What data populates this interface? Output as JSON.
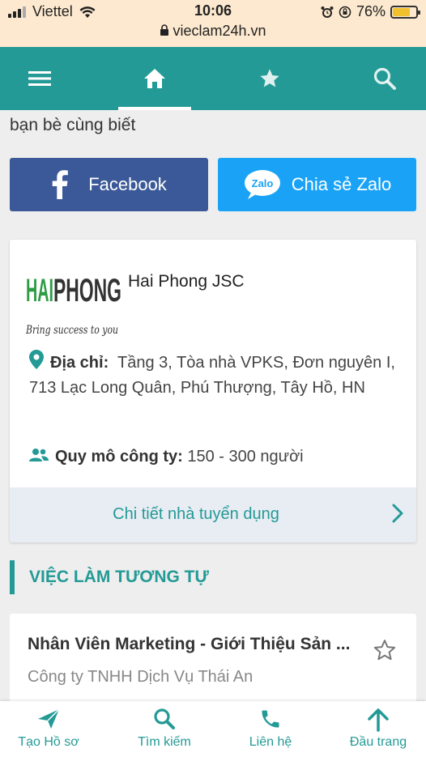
{
  "status_bar": {
    "carrier": "Viettel",
    "time": "10:06",
    "url": "vieclam24h.vn",
    "battery": "76%",
    "battery_level": 0.76
  },
  "app_bar": {
    "icons": [
      "menu-icon",
      "home-icon",
      "star-icon",
      "search-icon"
    ],
    "active": "home-icon"
  },
  "share": {
    "text": "bạn bè cùng biết",
    "facebook_label": "Facebook",
    "zalo_label": "Chia sẻ Zalo",
    "zalo_logo_text": "Zalo"
  },
  "company": {
    "logo_text_1": "HAI",
    "logo_text_2": "PHONG",
    "logo_tagline": "Bring success to you",
    "name": "Hai Phong JSC",
    "address_label": "Địa chỉ:",
    "address_value": "Tầng 3, Tòa nhà VPKS, Đơn nguyên I, 713 Lạc Long Quân, Phú Thượng, Tây Hồ, HN",
    "scale_label": "Quy mô công ty:",
    "scale_value": "150 - 300 người",
    "detail_link": "Chi tiết nhà tuyển dụng"
  },
  "similar": {
    "section_title": "VIỆC LÀM TƯƠNG TỰ",
    "jobs": [
      {
        "title": "Nhân Viên Marketing - Giới Thiệu Sản ...",
        "company": "Công ty TNHH Dịch Vụ Thái An"
      }
    ]
  },
  "bottom_nav": [
    {
      "label": "Tạo Hồ sơ",
      "icon": "send-icon"
    },
    {
      "label": "Tìm kiếm",
      "icon": "search-icon"
    },
    {
      "label": "Liên hệ",
      "icon": "phone-icon"
    },
    {
      "label": "Đầu trang",
      "icon": "arrow-up-icon"
    }
  ],
  "colors": {
    "brand": "#239a96",
    "facebook": "#3b5998",
    "zalo": "#1aa3f6",
    "status_bar": "#fde9cf"
  }
}
